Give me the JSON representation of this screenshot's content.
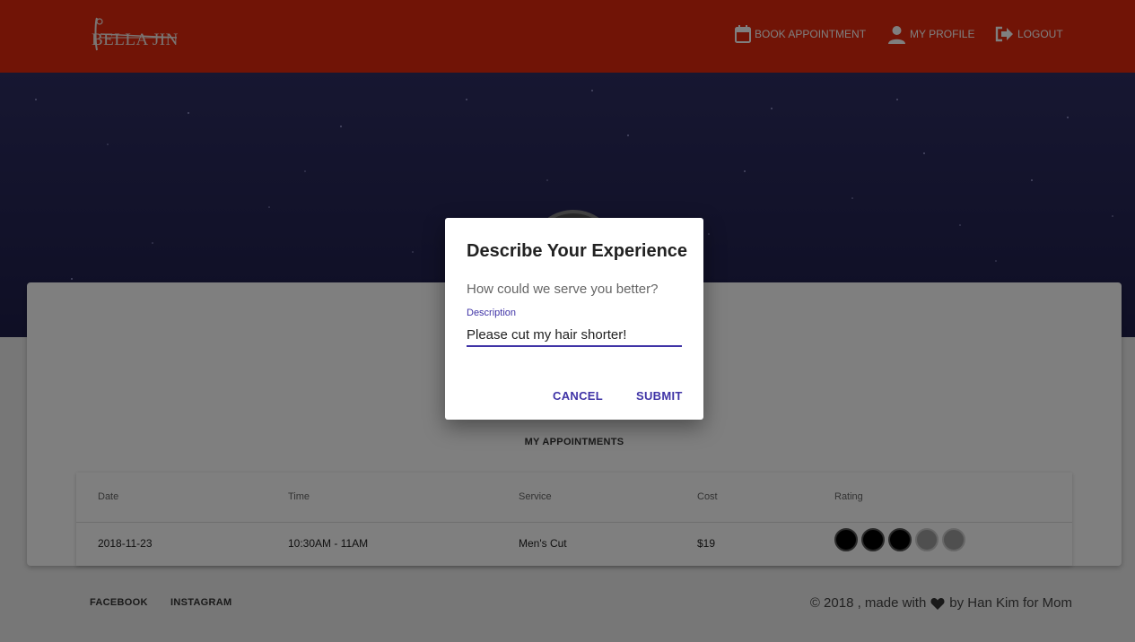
{
  "header": {
    "logo_text": "BELLA JIN",
    "nav": {
      "book": "BOOK APPOINTMENT",
      "profile": "MY PROFILE",
      "logout": "LOGOUT"
    }
  },
  "appointments": {
    "title": "MY APPOINTMENTS",
    "columns": [
      "Date",
      "Time",
      "Service",
      "Cost",
      "Rating"
    ],
    "rows": [
      {
        "date": "2018-11-23",
        "time": "10:30AM - 11AM",
        "service": "Men's Cut",
        "cost": "$19",
        "rating": 3,
        "rating_max": 5
      }
    ]
  },
  "footer": {
    "facebook": "FACEBOOK",
    "instagram": "INSTAGRAM",
    "copy_prefix": "© 2018 , made with",
    "copy_suffix": "by Han Kim for Mom"
  },
  "dialog": {
    "title": "Describe Your Experience",
    "text": "How could we serve you better?",
    "field_label": "Description",
    "field_value": "Please cut my hair shorter!",
    "cancel": "CANCEL",
    "submit": "SUBMIT"
  },
  "colors": {
    "header": "#e2290d",
    "accent": "#3f33a6"
  }
}
